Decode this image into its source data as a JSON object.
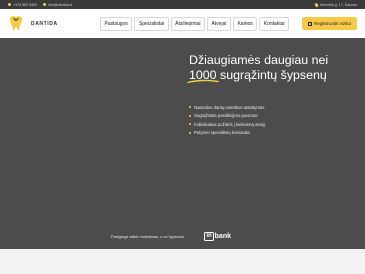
{
  "topbar": {
    "phone": "+370 683 3450",
    "email": "info@dantida.lt",
    "address": "Semelės g. 17, Kaunas"
  },
  "header": {
    "logo_text": "DANTIDA",
    "nav": [
      "Paslaugos",
      "Specialistai",
      "Atsiliepimai",
      "Atvejai",
      "Kainos",
      "Kontaktai"
    ],
    "cta_label": "Registruotis vizitui"
  },
  "hero": {
    "headline_line1": "Džiaugiamės daugiau nei",
    "headline_number": "1000",
    "headline_line2_rest": "sugrąžintų šypsenų",
    "bullets": [
      "Naturalus dantų estetikos atstatymas",
      "Sugrąžintas pasitikėjimo jausmas",
      "Individualus požiūris į kiekvieną atvejį",
      "Patyrusi specialistų komanda"
    ],
    "financing_text": "Prailginga atlikti mokėjimus, o ne šypsenų!",
    "financing_brand": "bank",
    "financing_brand_box": "in"
  },
  "colors": {
    "accent": "#f7c948",
    "hero_bg": "#4c4c4c",
    "topbar_bg": "#3a3a3a"
  }
}
